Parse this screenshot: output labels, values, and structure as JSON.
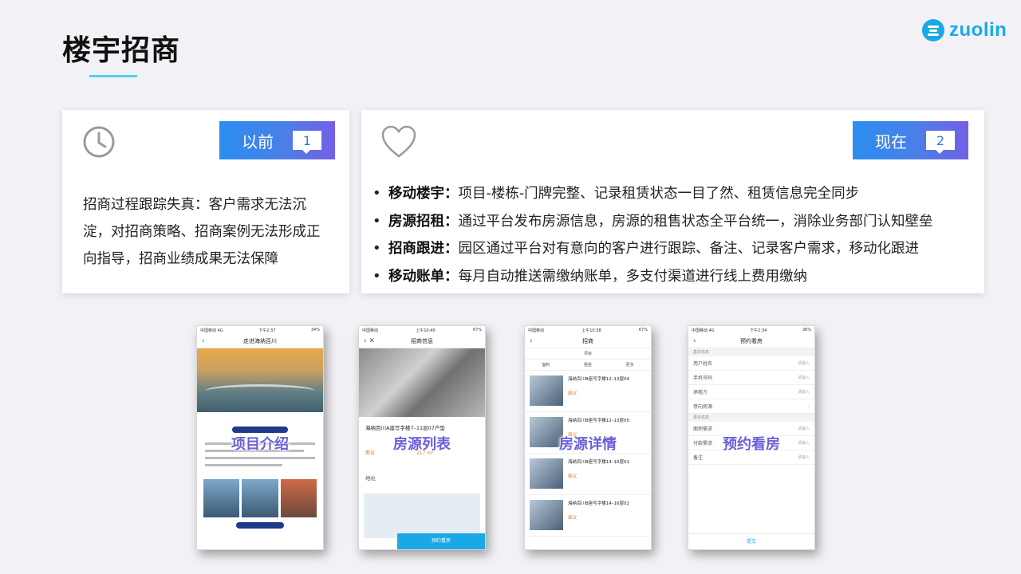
{
  "page": {
    "title": "楼宇招商",
    "brand": "zuolin",
    "accent_color": "#1aa9e6",
    "badge_gradient": [
      "#2b8ef0",
      "#7360e6"
    ]
  },
  "before": {
    "badge_label": "以前",
    "badge_number": "1",
    "icon": "clock-icon",
    "description": "招商过程跟踪失真：客户需求无法沉淀，对招商策略、招商案例无法形成正向指导，招商业绩成果无法保障"
  },
  "now": {
    "badge_label": "现在",
    "badge_number": "2",
    "icon": "heart-icon",
    "items": [
      {
        "label": "移动楼宇：",
        "text": "项目-楼栋-门牌完整、记录租赁状态一目了然、租赁信息完全同步"
      },
      {
        "label": "房源招租：",
        "text": "通过平台发布房源信息，房源的租售状态全平台统一，消除业务部门认知壁垒"
      },
      {
        "label": "招商跟进：",
        "text": "园区通过平台对有意向的客户进行跟踪、备注、记录客户需求，移动化跟进"
      },
      {
        "label": "移动账单：",
        "text": "每月自动推送需缴纳账单，多支付渠道进行线上费用缴纳"
      }
    ]
  },
  "screens": [
    {
      "label": "项目介绍",
      "status_left": "中国移动 4G",
      "status_time": "下午2:37",
      "status_right": "34%",
      "nav_title": "走进海纳百川"
    },
    {
      "label": "房源列表",
      "status_left": "中国移动",
      "status_time": "上午10:40",
      "status_right": "67%",
      "nav_title": "招商信息",
      "listing_title": "海纳百川A座写字楼7–11层07户型",
      "price_left": "面议",
      "price_right": "217 m²",
      "address_label": "地址",
      "button": "预约看房"
    },
    {
      "label": "房源详情",
      "status_left": "中国移动",
      "status_time": "上午10:38",
      "status_right": "67%",
      "nav_title": "招商",
      "filter_project": "项目",
      "filters": [
        "面积",
        "租金",
        "更多"
      ],
      "listings": [
        {
          "title": "海纳百川B座写字楼12–13层04",
          "price": "面议"
        },
        {
          "title": "海纳百川B座写字楼12–13层05",
          "price": "面议"
        },
        {
          "title": "海纳百川B座写字楼14–16层01",
          "price": "面议"
        },
        {
          "title": "海纳百川B座写字楼14–16层02",
          "price": "面议"
        }
      ]
    },
    {
      "label": "预约看房",
      "status_left": "中国移动 4G",
      "status_time": "下午2:34",
      "status_right": "36%",
      "nav_title": "预约看房",
      "section1": "基本信息",
      "fields1": [
        {
          "label": "用户姓名",
          "hint": "请输入"
        },
        {
          "label": "手机号码",
          "hint": "请输入"
        },
        {
          "label": "承租方",
          "hint": "请输入"
        },
        {
          "label": "意向房源",
          "hint": ""
        }
      ],
      "section2": "更多信息",
      "fields2": [
        {
          "label": "面积需求",
          "hint": "请输入"
        },
        {
          "label": "付款需求",
          "hint": "请输入"
        },
        {
          "label": "备注",
          "hint": "请输入"
        }
      ],
      "submit": "提交"
    }
  ]
}
